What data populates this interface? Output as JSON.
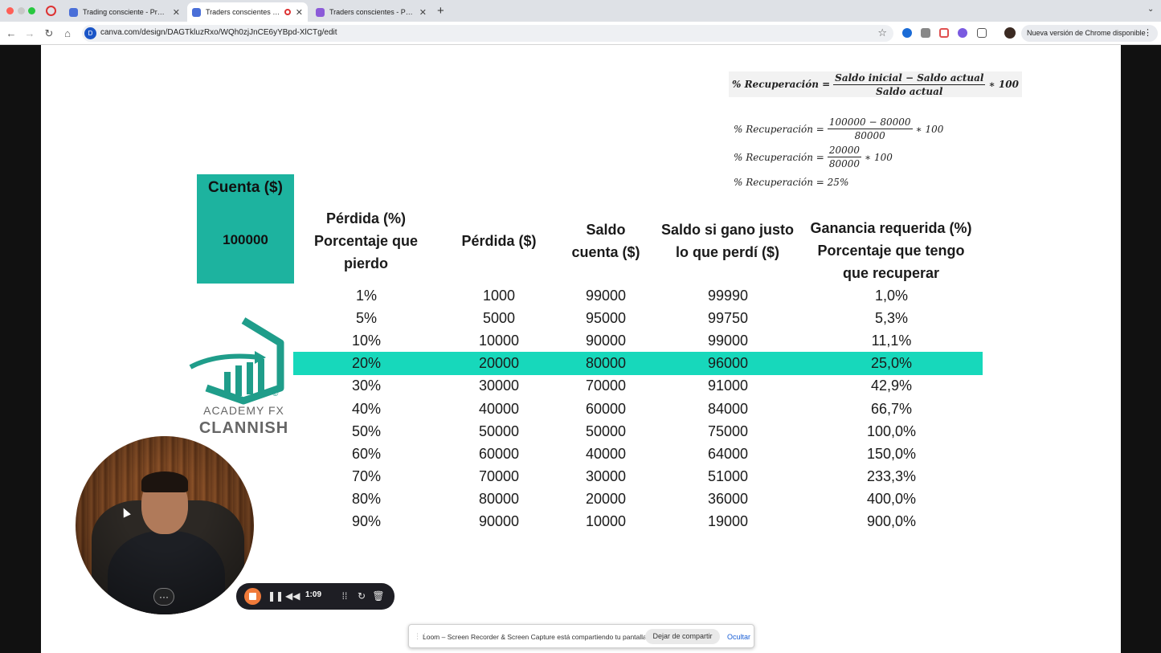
{
  "browser": {
    "tabs": [
      {
        "title": "Trading consciente - Presentación",
        "active": false
      },
      {
        "title": "Traders conscientes - Presentación",
        "active": true,
        "recording": true
      },
      {
        "title": "Traders conscientes - Presentación",
        "active": false
      }
    ],
    "url": "canva.com/design/DAGTkluzRxo/WQh0zjJnCE6yYBpd-XlCTg/edit",
    "site_badge": "D",
    "update_label": "Nueva versión de Chrome disponible"
  },
  "slide": {
    "formulas": {
      "main": {
        "lhs": "% Recuperación =",
        "num": "Saldo inicial − Saldo actual",
        "den": "Saldo actual",
        "tail": "∗ 100"
      },
      "step1": {
        "lhs": "% Recuperación =",
        "num": "100000 − 80000",
        "den": "80000",
        "tail": "∗ 100"
      },
      "step2": {
        "lhs": "% Recuperación =",
        "num": "20000",
        "den": "80000",
        "tail": "∗ 100"
      },
      "step3": {
        "text": "% Recuperación = 25%"
      }
    },
    "account": {
      "label": "Cuenta ($)",
      "value": "100000"
    },
    "headers": {
      "loss_pct": [
        "Pérdida (%)",
        "Porcentaje que",
        "pierdo"
      ],
      "loss_abs": [
        "Pérdida ($)"
      ],
      "balance": [
        "Saldo",
        "cuenta ($)"
      ],
      "balance_if_gain": [
        "Saldo si gano justo",
        "lo que perdí ($)"
      ],
      "required_gain": [
        "Ganancia requerida (%)",
        "Porcentaje que tengo",
        "que recuperar"
      ]
    },
    "highlight_row_index": 3,
    "highlight_color": "#17d8bb",
    "account_color": "#1db39f",
    "rows": [
      {
        "loss_pct": "1%",
        "loss_abs": "1000",
        "balance": "99000",
        "balance_if_gain": "99990",
        "required_gain": "1,0%"
      },
      {
        "loss_pct": "5%",
        "loss_abs": "5000",
        "balance": "95000",
        "balance_if_gain": "99750",
        "required_gain": "5,3%"
      },
      {
        "loss_pct": "10%",
        "loss_abs": "10000",
        "balance": "90000",
        "balance_if_gain": "99000",
        "required_gain": "11,1%"
      },
      {
        "loss_pct": "20%",
        "loss_abs": "20000",
        "balance": "80000",
        "balance_if_gain": "96000",
        "required_gain": "25,0%"
      },
      {
        "loss_pct": "30%",
        "loss_abs": "30000",
        "balance": "70000",
        "balance_if_gain": "91000",
        "required_gain": "42,9%"
      },
      {
        "loss_pct": "40%",
        "loss_abs": "40000",
        "balance": "60000",
        "balance_if_gain": "84000",
        "required_gain": "66,7%"
      },
      {
        "loss_pct": "50%",
        "loss_abs": "50000",
        "balance": "50000",
        "balance_if_gain": "75000",
        "required_gain": "100,0%"
      },
      {
        "loss_pct": "60%",
        "loss_abs": "60000",
        "balance": "40000",
        "balance_if_gain": "64000",
        "required_gain": "150,0%"
      },
      {
        "loss_pct": "70%",
        "loss_abs": "70000",
        "balance": "30000",
        "balance_if_gain": "51000",
        "required_gain": "233,3%"
      },
      {
        "loss_pct": "80%",
        "loss_abs": "80000",
        "balance": "20000",
        "balance_if_gain": "36000",
        "required_gain": "400,0%"
      },
      {
        "loss_pct": "90%",
        "loss_abs": "90000",
        "balance": "10000",
        "balance_if_gain": "19000",
        "required_gain": "900,0%"
      }
    ],
    "logo": {
      "line1": "ACADEMY FX",
      "line2": "CLANNISH",
      "mark": "©",
      "color": "#1f9d8a"
    }
  },
  "loom": {
    "timer": "1:09",
    "more_label": "···",
    "share_message": "Loom – Screen Recorder & Screen Capture está compartiendo tu pantalla.",
    "stop_share_label": "Dejar de compartir",
    "hide_label": "Ocultar"
  }
}
